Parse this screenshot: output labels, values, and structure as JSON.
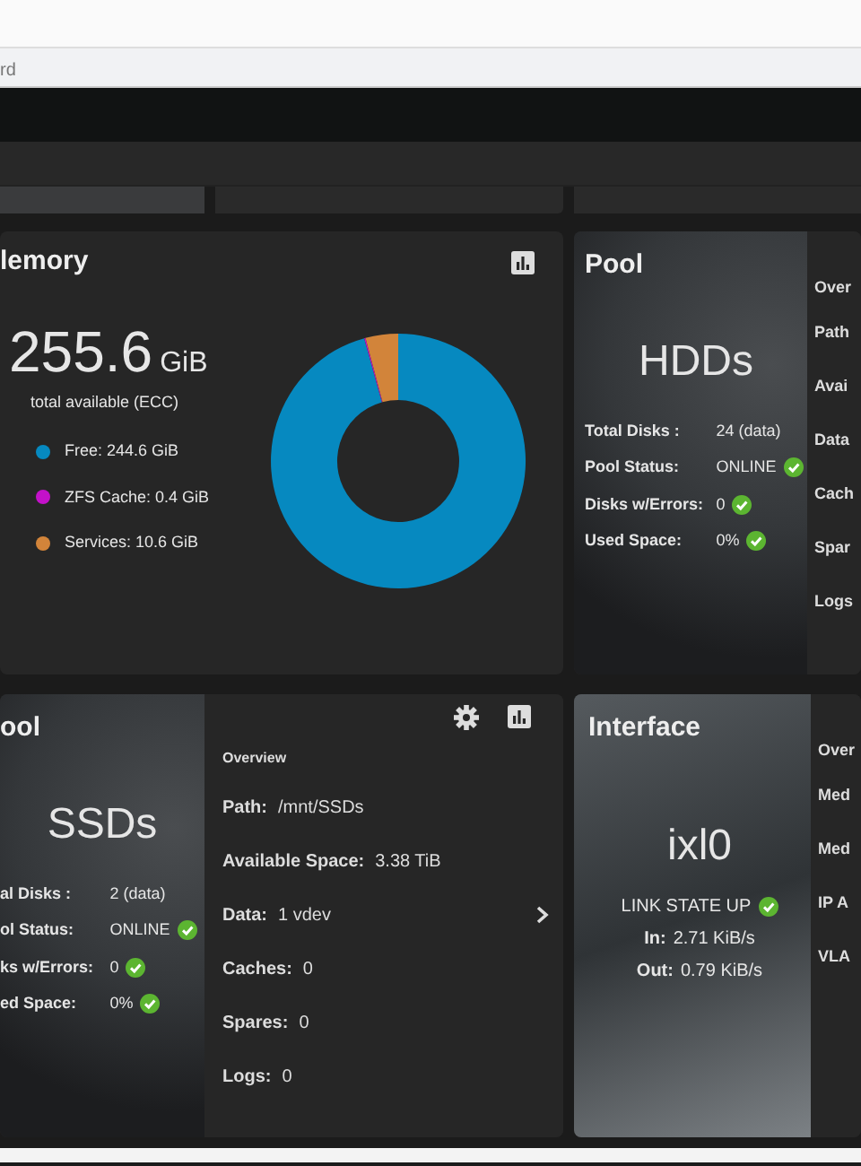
{
  "browser": {
    "address_fragment": "rd"
  },
  "memory": {
    "title": "lemory",
    "total": "255.6",
    "unit": "GiB",
    "caption": "total available (ECC)",
    "legend": [
      {
        "label": "Free: 244.6 GiB",
        "color": "#0689c0"
      },
      {
        "label": "ZFS Cache: 0.4 GiB",
        "color": "#c311c9"
      },
      {
        "label": "Services: 10.6 GiB",
        "color": "#d2843a"
      }
    ],
    "chart_data": {
      "type": "donut",
      "values": [
        95.7,
        0.16,
        4.14
      ]
    }
  },
  "hdd_pool": {
    "title": "Pool",
    "name": "HDDs",
    "stats": [
      {
        "label": "Total Disks :",
        "value": "24 (data)",
        "ok": false
      },
      {
        "label": "Pool Status:",
        "value": "ONLINE",
        "ok": true
      },
      {
        "label": "Disks w/Errors:",
        "value": "0",
        "ok": true
      },
      {
        "label": "Used Space:",
        "value": "0%",
        "ok": true
      }
    ],
    "overview": [
      "Over",
      "Path",
      "Avai",
      "Data",
      "Cach",
      "Spar",
      "Logs"
    ]
  },
  "ssd_pool": {
    "title": "ool",
    "name": "SSDs",
    "stats": [
      {
        "label": "al Disks :",
        "value": "2 (data)",
        "ok": false
      },
      {
        "label": "ol Status:",
        "value": "ONLINE",
        "ok": true
      },
      {
        "label": "ks w/Errors:",
        "value": "0",
        "ok": true
      },
      {
        "label": "ed Space:",
        "value": "0%",
        "ok": true
      }
    ],
    "overview_title": "Overview",
    "rows": [
      {
        "label": "Path:",
        "value": "/mnt/SSDs",
        "expandable": false
      },
      {
        "label": "Available Space:",
        "value": "3.38 TiB",
        "expandable": false
      },
      {
        "label": "Data:",
        "value": "1 vdev",
        "expandable": true
      },
      {
        "label": "Caches:",
        "value": "0",
        "expandable": false
      },
      {
        "label": "Spares:",
        "value": "0",
        "expandable": false
      },
      {
        "label": "Logs:",
        "value": "0",
        "expandable": false
      }
    ]
  },
  "interface": {
    "title": "Interface",
    "name": "ixl0",
    "link_state": "LINK STATE UP",
    "link_up": true,
    "traffic": [
      {
        "label": "In:",
        "value": "2.71 KiB/s"
      },
      {
        "label": "Out:",
        "value": "0.79 KiB/s"
      }
    ],
    "overview": [
      "Over",
      "Med",
      "Med",
      "IP A",
      "VLA"
    ]
  }
}
